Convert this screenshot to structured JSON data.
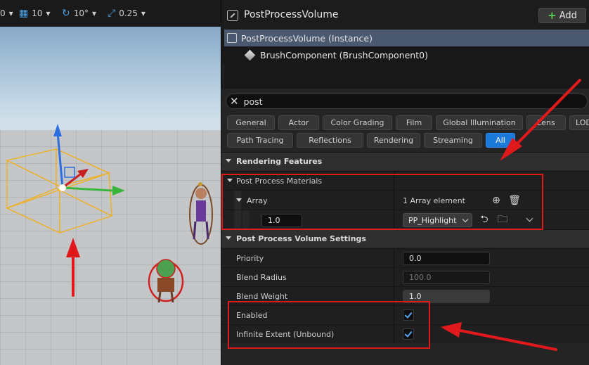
{
  "viewport_toolbar": {
    "items": [
      {
        "icon": "zero-value",
        "label": "0",
        "caret": "▾"
      },
      {
        "icon": "grid-snap-icon",
        "label": "10",
        "caret": "▾"
      },
      {
        "icon": "rotation-snap-icon",
        "label": "10°",
        "caret": "▾"
      },
      {
        "icon": "scale-snap-icon",
        "label": "0.25",
        "caret": "▾"
      }
    ]
  },
  "details": {
    "actor_title": "PostProcessVolume",
    "add_button_label": "Add",
    "tree": {
      "instance_label": "PostProcessVolume (Instance)",
      "brush_label": "BrushComponent (BrushComponent0)"
    },
    "search": {
      "value": "post"
    },
    "filter_chips_row1": [
      "General",
      "Actor",
      "Color Grading",
      "Film",
      "Global Illumination",
      "Lens",
      "LOD"
    ],
    "filter_chips_row2": [
      "Path Tracing",
      "Reflections",
      "Rendering",
      "Streaming",
      "All"
    ],
    "active_filter": "All",
    "sections": {
      "rendering_features": "Rendering Features",
      "post_process_materials": "Post Process Materials",
      "array_label": "Array",
      "array_count": "1 Array element",
      "array_weight": "1.0",
      "array_asset": "PP_Highlight",
      "ppv_settings": "Post Process Volume Settings",
      "priority_label": "Priority",
      "priority_value": "0.0",
      "blend_radius_label": "Blend Radius",
      "blend_radius_value": "100.0",
      "blend_weight_label": "Blend Weight",
      "blend_weight_value": "1.0",
      "enabled_label": "Enabled",
      "enabled_checked": true,
      "infinite_label": "Infinite Extent (Unbound)",
      "infinite_checked": true
    }
  },
  "colors": {
    "accent_blue": "#1a79d9",
    "annotation_red": "#e0191d",
    "selected_row": "#4a5870",
    "panel_bg": "#242424"
  }
}
